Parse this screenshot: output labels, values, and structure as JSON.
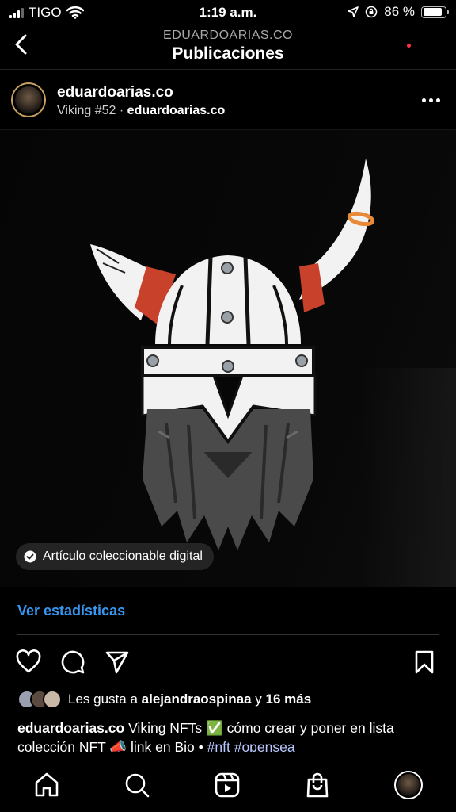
{
  "status_bar": {
    "carrier": "TIGO",
    "time": "1:19 a.m.",
    "battery_percent": "86 %",
    "battery_level": 0.86
  },
  "nav": {
    "account": "EDUARDOARIAS.CO",
    "title": "Publicaciones"
  },
  "post": {
    "username": "eduardoarias.co",
    "subtitle_item": "Viking #52",
    "subtitle_separator": "·",
    "subtitle_owner": "eduardoarias.co",
    "badge_label": "Artículo coleccionable digital",
    "stats_link": "Ver estadísticas",
    "likes_prefix": "Les gusta a",
    "likes_user": "alejandraospinaa",
    "likes_joiner": "y",
    "likes_more": "16 más",
    "caption_user": "eduardoarias.co",
    "caption_text_1": "Viking NFTs ✅ cómo crear y poner en lista colección NFT 📣 link en Bio •",
    "caption_tag_1": "#nft",
    "caption_tag_2": "#opensea"
  },
  "icons": {
    "back": "chevron-left-icon",
    "more": "more-horizontal-icon",
    "like": "heart-icon",
    "comment": "comment-icon",
    "share": "send-icon",
    "save": "bookmark-icon",
    "home": "home-icon",
    "search": "search-icon",
    "reels": "reels-icon",
    "shop": "shop-bag-icon"
  },
  "colors": {
    "link_blue": "#3797f0",
    "horn_ring": "#e8893a",
    "helmet_red": "#c8412a",
    "notification": "#ff3040"
  }
}
